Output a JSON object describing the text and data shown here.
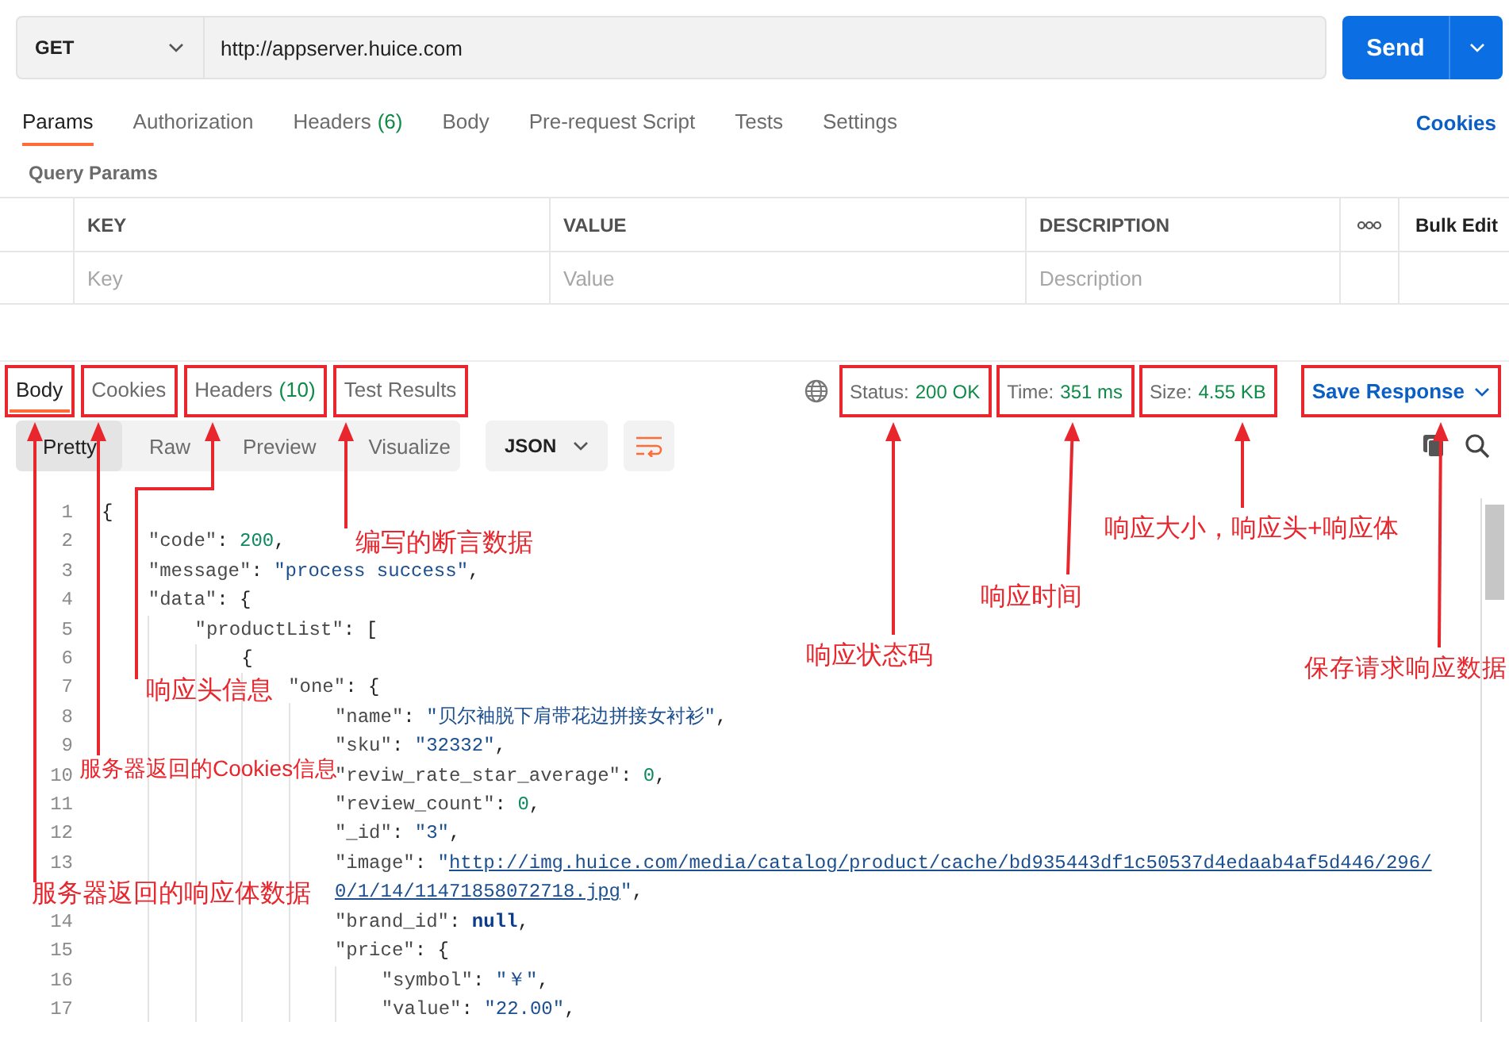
{
  "request": {
    "method": "GET",
    "url": "http://appserver.huice.com",
    "send": "Send"
  },
  "request_tabs": [
    {
      "label": "Params",
      "selected": true
    },
    {
      "label": "Authorization",
      "selected": false
    },
    {
      "label": "Headers",
      "count": "(6)",
      "selected": false
    },
    {
      "label": "Body",
      "selected": false
    },
    {
      "label": "Pre-request Script",
      "selected": false
    },
    {
      "label": "Tests",
      "selected": false
    },
    {
      "label": "Settings",
      "selected": false
    }
  ],
  "cookies_link": "Cookies",
  "query_params": {
    "title": "Query Params",
    "columns": [
      "KEY",
      "VALUE",
      "DESCRIPTION"
    ],
    "bulk_edit": "Bulk Edit",
    "placeholders": [
      "Key",
      "Value",
      "Description"
    ]
  },
  "response": {
    "tabs": [
      {
        "label": "Body",
        "selected": true,
        "highlighted": true
      },
      {
        "label": "Cookies",
        "selected": false,
        "highlighted": true
      },
      {
        "label": "Headers",
        "count": "(10)",
        "selected": false,
        "highlighted": true
      },
      {
        "label": "Test Results",
        "selected": false,
        "highlighted": true
      }
    ],
    "stats": [
      {
        "label": "Status:",
        "value": "200 OK",
        "highlighted": true
      },
      {
        "label": "Time:",
        "value": "351 ms",
        "highlighted": true
      },
      {
        "label": "Size:",
        "value": "4.55 KB",
        "highlighted": true
      }
    ],
    "save": {
      "label": "Save Response",
      "highlighted": true
    },
    "views": [
      {
        "label": "Pretty",
        "selected": true
      },
      {
        "label": "Raw",
        "selected": false
      },
      {
        "label": "Preview",
        "selected": false
      },
      {
        "label": "Visualize",
        "selected": false
      }
    ],
    "format": "JSON",
    "code_lines": [
      {
        "number": "1",
        "tokens": [
          {
            "kind": "punct",
            "text": "{"
          }
        ]
      },
      {
        "number": "2",
        "tokens": [
          {
            "kind": "key",
            "text": "\"code\""
          },
          {
            "kind": "punct",
            "text": ": "
          },
          {
            "kind": "number",
            "text": "200"
          },
          {
            "kind": "punct",
            "text": ","
          }
        ]
      },
      {
        "number": "3",
        "tokens": [
          {
            "kind": "key",
            "text": "\"message\""
          },
          {
            "kind": "punct",
            "text": ": "
          },
          {
            "kind": "string",
            "text": "\"process success\""
          },
          {
            "kind": "punct",
            "text": ","
          }
        ]
      },
      {
        "number": "4",
        "tokens": [
          {
            "kind": "key",
            "text": "\"data\""
          },
          {
            "kind": "punct",
            "text": ": {"
          }
        ]
      },
      {
        "number": "5",
        "tokens": [
          {
            "kind": "key",
            "text": "\"productList\""
          },
          {
            "kind": "punct",
            "text": ": ["
          }
        ]
      },
      {
        "number": "6",
        "tokens": [
          {
            "kind": "punct",
            "text": "{"
          }
        ]
      },
      {
        "number": "7",
        "tokens": [
          {
            "kind": "key",
            "text": "\"one\""
          },
          {
            "kind": "punct",
            "text": ": {"
          }
        ]
      },
      {
        "number": "8",
        "tokens": [
          {
            "kind": "key",
            "text": "\"name\""
          },
          {
            "kind": "punct",
            "text": ": "
          },
          {
            "kind": "string",
            "text": "\"贝尔袖脱下肩带花边拼接女衬衫\""
          },
          {
            "kind": "punct",
            "text": ","
          }
        ]
      },
      {
        "number": "9",
        "tokens": [
          {
            "kind": "key",
            "text": "\"sku\""
          },
          {
            "kind": "punct",
            "text": ": "
          },
          {
            "kind": "string",
            "text": "\"32332\""
          },
          {
            "kind": "punct",
            "text": ","
          }
        ]
      },
      {
        "number": "10",
        "tokens": [
          {
            "kind": "key",
            "text": "\"reviw_rate_star_average\""
          },
          {
            "kind": "punct",
            "text": ": "
          },
          {
            "kind": "number",
            "text": "0"
          },
          {
            "kind": "punct",
            "text": ","
          }
        ]
      },
      {
        "number": "11",
        "tokens": [
          {
            "kind": "key",
            "text": "\"review_count\""
          },
          {
            "kind": "punct",
            "text": ": "
          },
          {
            "kind": "number",
            "text": "0"
          },
          {
            "kind": "punct",
            "text": ","
          }
        ]
      },
      {
        "number": "12",
        "tokens": [
          {
            "kind": "key",
            "text": "\"_id\""
          },
          {
            "kind": "punct",
            "text": ": "
          },
          {
            "kind": "string",
            "text": "\"3\""
          },
          {
            "kind": "punct",
            "text": ","
          }
        ]
      },
      {
        "number": "13",
        "tokens": [
          {
            "kind": "key",
            "text": "\"image\""
          },
          {
            "kind": "punct",
            "text": ": "
          },
          {
            "kind": "string",
            "text": "\""
          },
          {
            "kind": "link",
            "text": "http://img.huice.com/media/catalog/product/cache/bd935443df1c50537d4edaab4af5d446/296/0/1/14/11471858072718.jpg"
          },
          {
            "kind": "string",
            "text": "\""
          },
          {
            "kind": "punct",
            "text": ","
          }
        ]
      },
      {
        "number": "14",
        "tokens": [
          {
            "kind": "key",
            "text": "\"brand_id\""
          },
          {
            "kind": "punct",
            "text": ": "
          },
          {
            "kind": "null",
            "text": "null"
          },
          {
            "kind": "punct",
            "text": ","
          }
        ]
      },
      {
        "number": "15",
        "tokens": [
          {
            "kind": "key",
            "text": "\"price\""
          },
          {
            "kind": "punct",
            "text": ": {"
          }
        ]
      },
      {
        "number": "16",
        "tokens": [
          {
            "kind": "key",
            "text": "\"symbol\""
          },
          {
            "kind": "punct",
            "text": ": "
          },
          {
            "kind": "string",
            "text": "\"￥\""
          },
          {
            "kind": "punct",
            "text": ","
          }
        ]
      },
      {
        "number": "17",
        "tokens": [
          {
            "kind": "key",
            "text": "\"value\""
          },
          {
            "kind": "punct",
            "text": ": "
          },
          {
            "kind": "string",
            "text": "\"22.00\""
          },
          {
            "kind": "punct",
            "text": ","
          }
        ]
      }
    ]
  },
  "annotations": [
    {
      "label": "编写的断言数据"
    },
    {
      "label": "响应头信息"
    },
    {
      "label": "服务器返回的Cookies信息"
    },
    {
      "label": "服务器返回的响应体数据"
    },
    {
      "label": "响应状态码"
    },
    {
      "label": "响应时间"
    },
    {
      "label": "响应大小，响应头+响应体"
    },
    {
      "label": "保存请求响应数据"
    }
  ]
}
